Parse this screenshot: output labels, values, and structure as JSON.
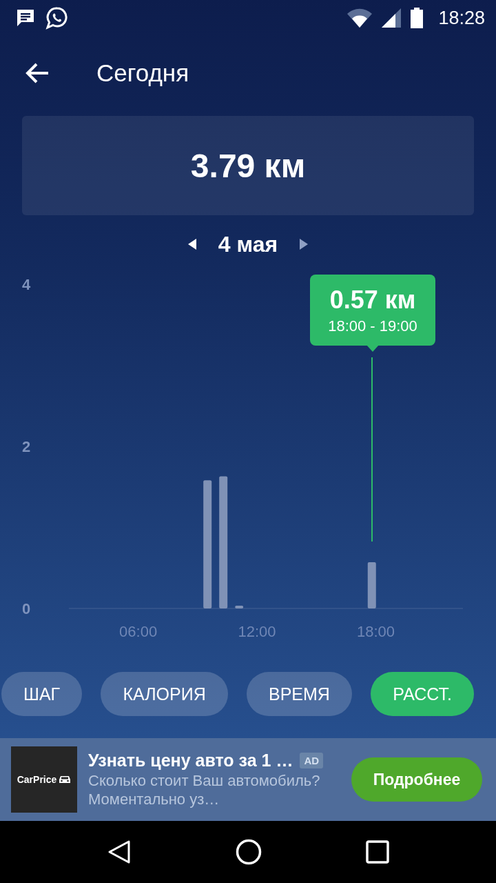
{
  "status_bar": {
    "time": "18:28"
  },
  "app_bar": {
    "title": "Сегодня"
  },
  "summary": {
    "value": "3.79 км"
  },
  "date_nav": {
    "label": "4 мая"
  },
  "chart": {
    "tooltip": {
      "value": "0.57 км",
      "range": "18:00 - 19:00"
    },
    "chart_data": {
      "type": "bar",
      "x": [
        9.5,
        10.3,
        11.1,
        17.8
      ],
      "values": [
        1.58,
        1.63,
        0.03,
        0.57
      ],
      "xlim": [
        2.5,
        22.4
      ],
      "ylim": [
        0,
        4
      ],
      "xticks": [
        {
          "value": 6,
          "label": "06:00"
        },
        {
          "value": 12,
          "label": "12:00"
        },
        {
          "value": 18,
          "label": "18:00"
        }
      ],
      "yticks": [
        0,
        2,
        4
      ]
    }
  },
  "metrics": [
    {
      "label": "ШАГ",
      "selected": false
    },
    {
      "label": "КАЛОРИЯ",
      "selected": false
    },
    {
      "label": "ВРЕМЯ",
      "selected": false
    },
    {
      "label": "РАССТ.",
      "selected": true
    }
  ],
  "ad": {
    "logo": "CarPrice",
    "title": "Узнать цену авто за 1 …",
    "badge": "AD",
    "description": "Сколько стоит Ваш автомобиль? Моментально уз…",
    "button": "Подробнее"
  }
}
